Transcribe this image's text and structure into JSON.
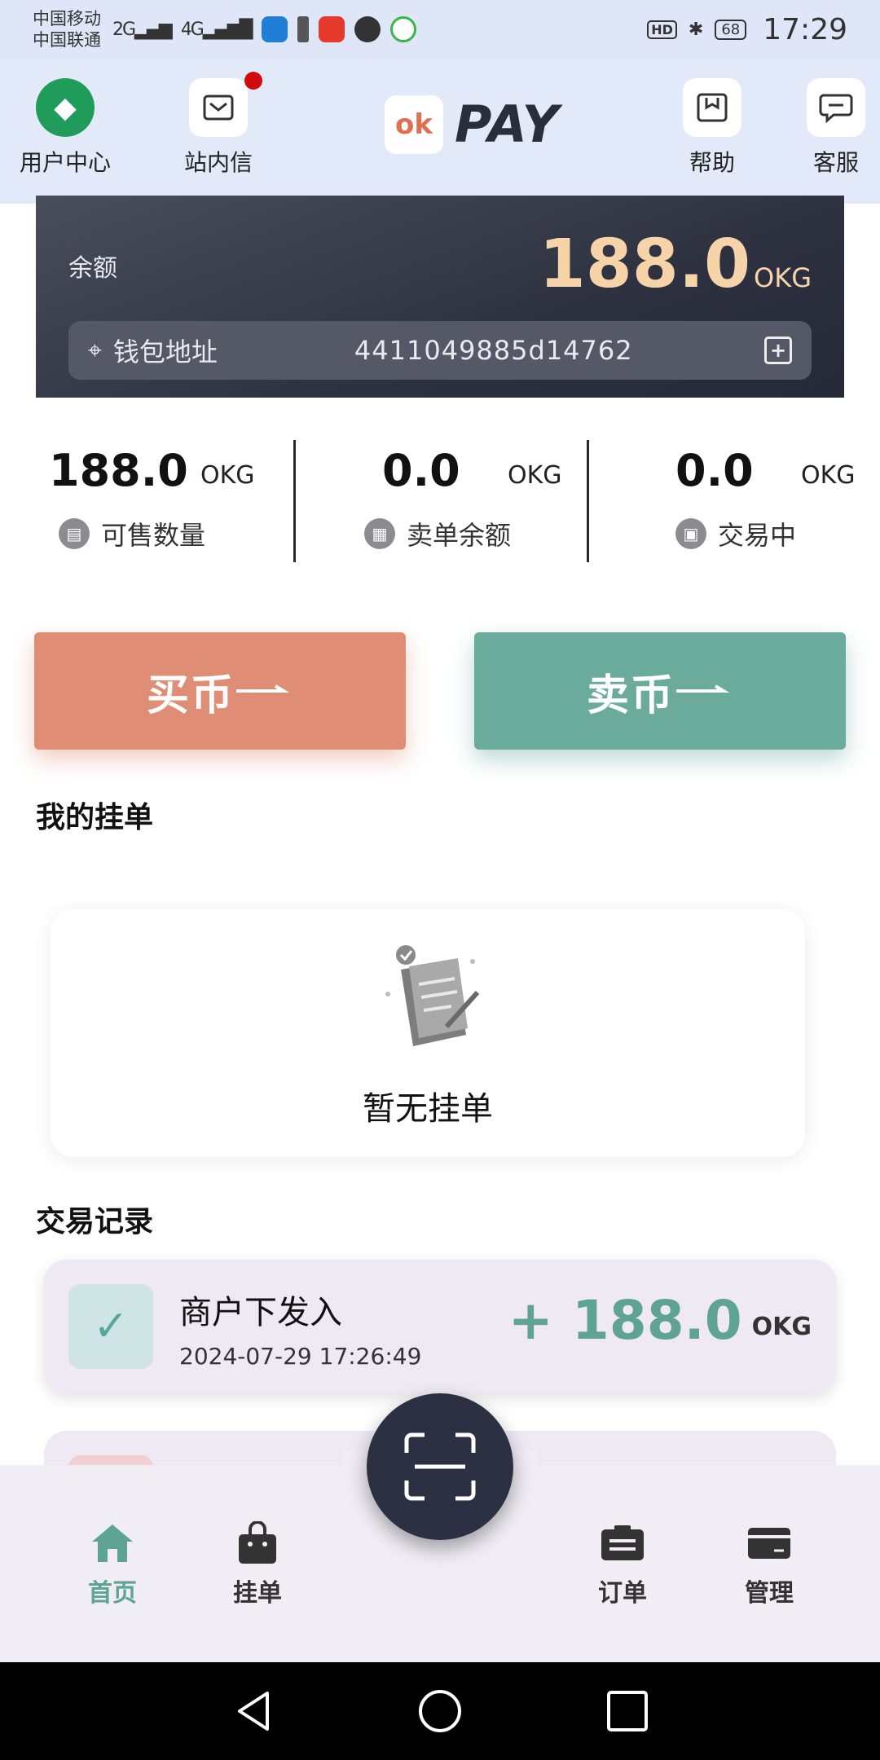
{
  "status_bar": {
    "carrier1": "中国移动",
    "carrier2": "中国联通",
    "net1": "2G",
    "net2": "4G",
    "hd": "HD",
    "battery": "68",
    "time": "17:29"
  },
  "header": {
    "user_center": "用户中心",
    "messages": "站内信",
    "logo_mark": "ok",
    "logo_text": "PAY",
    "help": "帮助",
    "service": "客服"
  },
  "balance": {
    "label": "余额",
    "value": "188.0",
    "unit": "OKG",
    "wallet_label": "钱包地址",
    "wallet_address": "4411049885d14762"
  },
  "stats": [
    {
      "value": "188.0",
      "unit": "OKG",
      "label": "可售数量"
    },
    {
      "value": "0.0",
      "unit": "OKG",
      "label": "卖单余额"
    },
    {
      "value": "0.0",
      "unit": "OKG",
      "label": "交易中"
    }
  ],
  "actions": {
    "buy": "买币",
    "sell": "卖币"
  },
  "orders": {
    "title": "我的挂单",
    "empty_text": "暂无挂单"
  },
  "records": {
    "title": "交易记录",
    "items": [
      {
        "title": "商户下发入",
        "datetime": "2024-07-29 17:26:49",
        "amount": "+ 188.0",
        "unit": "OKG"
      }
    ]
  },
  "nav": {
    "home": "首页",
    "listing": "挂单",
    "orders": "订单",
    "manage": "管理"
  },
  "colors": {
    "accent_green": "#5fa493",
    "buy": "#e08d75",
    "sell": "#6aab9b",
    "balance_gold": "#f7d3a9",
    "dark": "#2b3042"
  }
}
